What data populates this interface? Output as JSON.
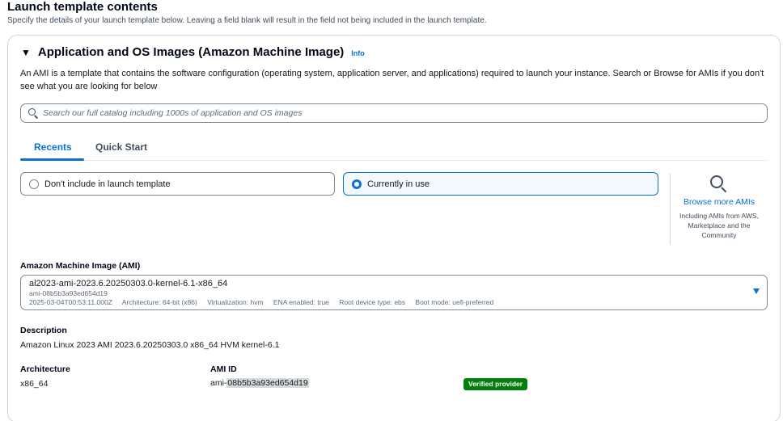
{
  "header": {
    "title": "Launch template contents",
    "description": "Specify the details of your launch template below. Leaving a field blank will result in the field not being included in the launch template."
  },
  "section": {
    "caret": "▼",
    "title": "Application and OS Images (Amazon Machine Image)",
    "info_label": "Info",
    "intro": "An AMI is a template that contains the software configuration (operating system, application server, and applications) required to launch your instance. Search or Browse for AMIs if you don't see what you are looking for below"
  },
  "search": {
    "placeholder": "Search our full catalog including 1000s of application and OS images",
    "icon": "search-icon"
  },
  "tabs": [
    {
      "label": "Recents",
      "active": true
    },
    {
      "label": "Quick Start",
      "active": false
    }
  ],
  "options": {
    "dont_include": {
      "label": "Don't include in launch template",
      "selected": false
    },
    "currently_in_use": {
      "label": "Currently in use",
      "selected": true
    }
  },
  "browse": {
    "icon": "search-icon",
    "link": "Browse more AMIs",
    "note": "Including AMIs from AWS, Marketplace and the Community"
  },
  "ami": {
    "label": "Amazon Machine Image (AMI)",
    "name": "al2023-ami-2023.6.20250303.0-kernel-6.1-x86_64",
    "id_sub": "ami-08b5b3a93ed654d19",
    "meta": {
      "date": "2025-03-04T00:53:11.000Z",
      "architecture": "Architecture: 64-bit (x86)",
      "virtualization": "Virtualization: hvm",
      "ena": "ENA enabled: true",
      "root_device": "Root device type: ebs",
      "boot_mode": "Boot mode: uefi-preferred"
    }
  },
  "details": {
    "description_label": "Description",
    "description_value": "Amazon Linux 2023 AMI 2023.6.20250303.0 x86_64 HVM kernel-6.1",
    "architecture_label": "Architecture",
    "architecture_value": "x86_64",
    "ami_id_label": "AMI ID",
    "ami_id_prefix": "ami-",
    "ami_id_highlighted": "08b5b3a93ed654d19",
    "badge": "Verified provider"
  },
  "colors": {
    "accent": "#0972d3",
    "badge_green": "#037f0c",
    "selected_bg": "#f2f8fd"
  }
}
